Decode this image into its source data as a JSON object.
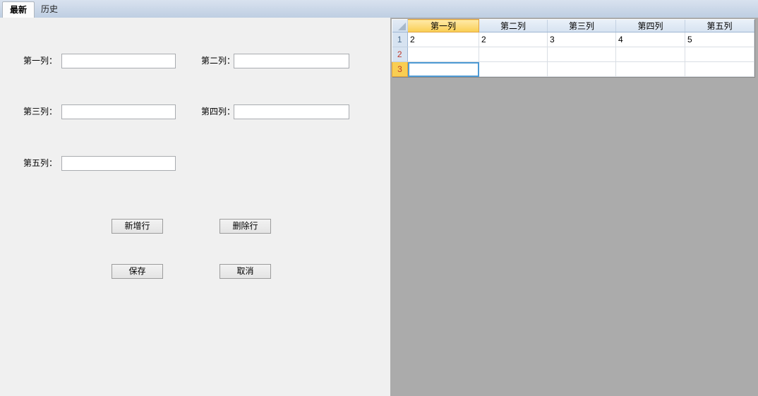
{
  "tabs": {
    "latest": {
      "label": "最新",
      "active": true
    },
    "history": {
      "label": "历史",
      "active": false
    }
  },
  "form": {
    "fields": [
      {
        "label": "第一列：",
        "value": ""
      },
      {
        "label": "第二列：",
        "value": ""
      },
      {
        "label": "第三列：",
        "value": ""
      },
      {
        "label": "第四列：",
        "value": ""
      },
      {
        "label": "第五列：",
        "value": ""
      }
    ],
    "buttons": {
      "add_row": "新增行",
      "delete_row": "删除行",
      "save": "保存",
      "cancel": "取消"
    }
  },
  "grid": {
    "columns": [
      "第一列",
      "第二列",
      "第三列",
      "第四列",
      "第五列"
    ],
    "rows": [
      {
        "num": "1",
        "cells": [
          "2",
          "2",
          "3",
          "4",
          "5"
        ]
      },
      {
        "num": "2",
        "cells": [
          "",
          "",
          "",
          "",
          ""
        ]
      },
      {
        "num": "3",
        "cells": [
          "",
          "",
          "",
          "",
          ""
        ]
      }
    ],
    "selected_cell": {
      "row": "3",
      "column": "第一列"
    }
  },
  "colors": {
    "tabstrip": "#C4D2E5",
    "panel": "#F0F0F0",
    "workspace": "#ABABAB",
    "header_blue": "#D7E3F1",
    "header_selected_orange": "#F9CE52",
    "selected_border_orange": "#E0A243",
    "cell_selection_blue": "#4E9AD4",
    "row_number_red": "#C0392B",
    "row_number_blue": "#4C6C8C"
  }
}
